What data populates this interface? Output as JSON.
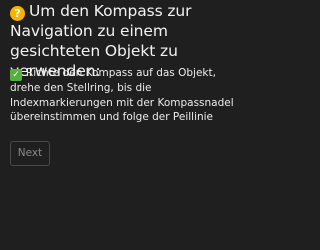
{
  "question": {
    "icon": "question-mark-emoji-icon",
    "icon_glyph": "?",
    "icon_color": "#f5b400",
    "text": "Um den Kompass zur Navigation zu einem gesichteten Objekt zu verwenden:"
  },
  "answer": {
    "icon": "check-mark-emoji-icon",
    "icon_glyph": "✓",
    "icon_color": "#57b03e",
    "text": "Richte den Kompass auf das Objekt, drehe den Stellring, bis die Indexmarkierungen mit der Kompassnadel übereinstimmen und folge der Peillinie"
  },
  "buttons": {
    "next_label": "Next"
  }
}
